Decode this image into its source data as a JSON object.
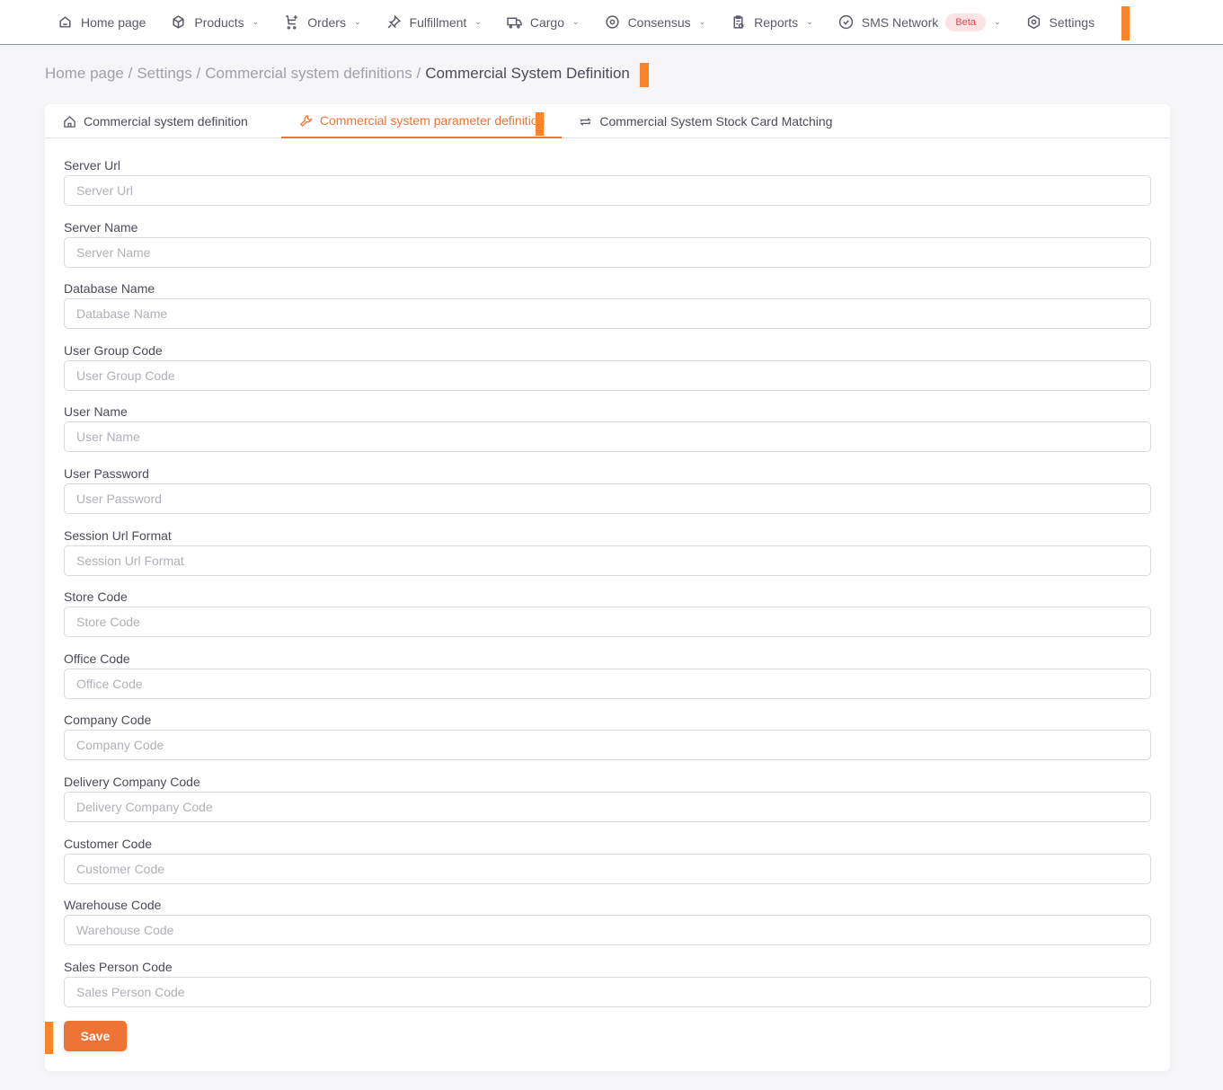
{
  "nav": [
    {
      "label": "Home page",
      "icon": "home-icon",
      "dropdown": false
    },
    {
      "label": "Products",
      "icon": "box-icon",
      "dropdown": true
    },
    {
      "label": "Orders",
      "icon": "cart-icon",
      "dropdown": true
    },
    {
      "label": "Fulfillment",
      "icon": "pin-icon",
      "dropdown": true
    },
    {
      "label": "Cargo",
      "icon": "truck-icon",
      "dropdown": true
    },
    {
      "label": "Consensus",
      "icon": "target-icon",
      "dropdown": true
    },
    {
      "label": "Reports",
      "icon": "clipboard-icon",
      "dropdown": true
    },
    {
      "label": "SMS Network",
      "icon": "check-circle-icon",
      "dropdown": true,
      "badge": "Beta"
    },
    {
      "label": "Settings",
      "icon": "hexagon-gear-icon",
      "dropdown": false
    }
  ],
  "breadcrumb": [
    "Home page",
    "Settings",
    "Commercial system definitions",
    "Commercial System Definition"
  ],
  "tabs": [
    "Commercial system definition",
    "Commercial system parameter definition",
    "Commercial System Stock Card Matching"
  ],
  "fields": [
    {
      "label": "Server Url",
      "placeholder": "Server Url"
    },
    {
      "label": "Server Name",
      "placeholder": "Server Name"
    },
    {
      "label": "Database Name",
      "placeholder": "Database Name"
    },
    {
      "label": "User Group Code",
      "placeholder": "User Group Code"
    },
    {
      "label": "User Name",
      "placeholder": "User Name"
    },
    {
      "label": "User Password",
      "placeholder": "User Password"
    },
    {
      "label": "Session Url Format",
      "placeholder": "Session Url Format"
    },
    {
      "label": "Store Code",
      "placeholder": "Store Code"
    },
    {
      "label": "Office Code",
      "placeholder": "Office Code"
    },
    {
      "label": "Company Code",
      "placeholder": "Company Code"
    },
    {
      "label": "Delivery Company Code",
      "placeholder": "Delivery Company Code"
    },
    {
      "label": "Customer Code",
      "placeholder": "Customer Code"
    },
    {
      "label": "Warehouse Code",
      "placeholder": "Warehouse Code"
    },
    {
      "label": "Sales Person Code",
      "placeholder": "Sales Person Code"
    }
  ],
  "save_label": "Save",
  "colors": {
    "accent": "#ee7436",
    "badge_bg": "#fde4e4",
    "badge_text": "#e5484d"
  }
}
